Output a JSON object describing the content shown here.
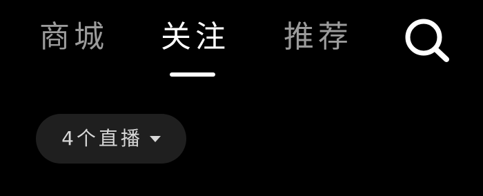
{
  "nav": {
    "tabs": [
      {
        "label": "商城",
        "active": false
      },
      {
        "label": "关注",
        "active": true
      },
      {
        "label": "推荐",
        "active": false
      }
    ],
    "search_icon": "search-icon"
  },
  "live_filter": {
    "label": "4个直播",
    "icon": "caret-down-icon"
  },
  "colors": {
    "background": "#000000",
    "active_tab": "#ffffff",
    "inactive_tab": "#9b9b9b",
    "pill_background": "#1f1f1f",
    "pill_text": "#d8d8d8"
  }
}
